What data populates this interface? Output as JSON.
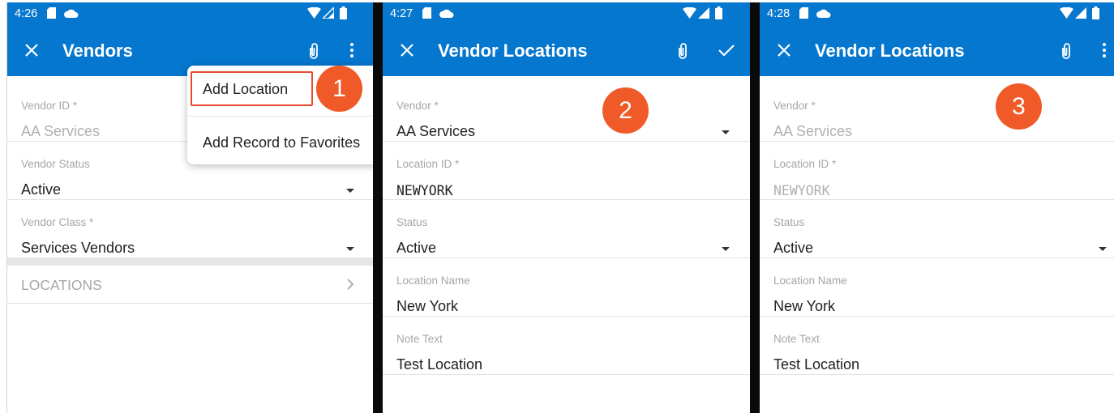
{
  "accent_color": "#0677cf",
  "badge_color": "#f05a28",
  "screens": [
    {
      "time": "4:26",
      "title": "Vendors",
      "icons": [
        "sd-card-icon",
        "cloud-icon",
        "wifi-icon",
        "signal-icon",
        "battery-icon",
        "close-icon",
        "attachment-icon",
        "more-vert-icon"
      ],
      "fields": [
        {
          "label": "Vendor ID *",
          "value": "AA Services"
        },
        {
          "label": "Vendor Status",
          "value": "Active"
        },
        {
          "label": "Vendor Class *",
          "value": "Services Vendors"
        }
      ],
      "locations_label": "LOCATIONS",
      "menu": [
        "Add Location",
        "Add Record to Favorites"
      ],
      "badge": "1"
    },
    {
      "time": "4:27",
      "title": "Vendor Locations",
      "icons": [
        "sd-card-icon",
        "cloud-icon",
        "wifi-icon",
        "signal-icon",
        "battery-icon",
        "close-icon",
        "attachment-icon",
        "check-icon"
      ],
      "fields": [
        {
          "label": "Vendor *",
          "value": "AA Services"
        },
        {
          "label": "Location ID *",
          "value": "NEWYORK"
        },
        {
          "label": "Status",
          "value": "Active"
        },
        {
          "label": "Location Name",
          "value": "New York"
        },
        {
          "label": "Note Text",
          "value": "Test Location"
        }
      ],
      "badge": "2"
    },
    {
      "time": "4:28",
      "title": "Vendor Locations",
      "icons": [
        "sd-card-icon",
        "cloud-icon",
        "wifi-icon",
        "signal-icon",
        "battery-icon",
        "close-icon",
        "attachment-icon",
        "more-vert-icon"
      ],
      "fields": [
        {
          "label": "Vendor *",
          "value": "AA Services"
        },
        {
          "label": "Location ID *",
          "value": "NEWYORK"
        },
        {
          "label": "Status",
          "value": "Active"
        },
        {
          "label": "Location Name",
          "value": "New York"
        },
        {
          "label": "Note Text",
          "value": "Test Location"
        }
      ],
      "badge": "3"
    }
  ]
}
